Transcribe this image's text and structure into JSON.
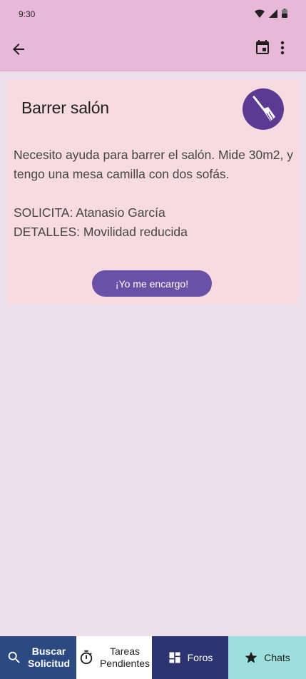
{
  "status_bar": {
    "time": "9:30"
  },
  "app_bar": {
    "back_icon": "arrow-back-icon",
    "calendar_icon": "calendar-event-icon",
    "more_icon": "more-vert-icon"
  },
  "task": {
    "title": "Barrer salón",
    "icon": "broom-icon",
    "description": "Necesito ayuda para barrer el salón. Mide 30m2, y tengo una mesa camilla con dos sofás.",
    "requester_line": "SOLICITA: Atanasio García",
    "details_line": "DETALLES: Movilidad reducida",
    "action_label": "¡Yo me encargo!"
  },
  "bottom_nav": {
    "items": [
      {
        "label_line1": "Buscar",
        "label_line2": "Solicitud",
        "icon": "search-icon",
        "color": "#2b4a82"
      },
      {
        "label_line1": "Tareas",
        "label_line2": "Pendientes",
        "icon": "timer-icon",
        "color": "#ffffff"
      },
      {
        "label": "Foros",
        "icon": "dashboard-icon",
        "color": "#2e3372"
      },
      {
        "label": "Chats",
        "icon": "star-icon",
        "color": "#9ddede"
      }
    ]
  },
  "colors": {
    "app_bar": "#e8b8d8",
    "background": "#ede0ea",
    "card": "#f7dbe0",
    "accent": "#6b50a8",
    "avatar": "#5a3a92"
  }
}
